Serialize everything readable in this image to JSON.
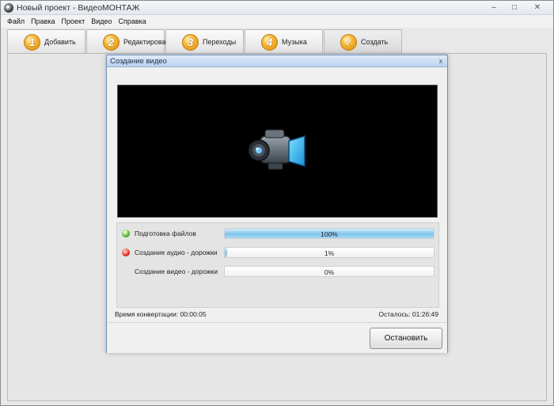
{
  "window": {
    "title": "Новый проект - ВидеоМОНТАЖ",
    "icon": "app-logo-icon",
    "controls": {
      "minimize": "–",
      "maximize": "□",
      "close": "✕"
    }
  },
  "menu": [
    "Файл",
    "Правка",
    "Проект",
    "Видео",
    "Справка"
  ],
  "tabs": [
    {
      "num": "1",
      "label": "Добавить"
    },
    {
      "num": "2",
      "label": "Редактировать"
    },
    {
      "num": "3",
      "label": "Переходы"
    },
    {
      "num": "4",
      "label": "Музыка"
    },
    {
      "num": "✓",
      "label": "Создать",
      "active": true
    }
  ],
  "dialog": {
    "title": "Создание видео",
    "close": "x",
    "preview_icon": "video-camera-icon",
    "tasks": [
      {
        "label": "Подготовка файлов",
        "percent_text": "100%",
        "progress": 1.0,
        "status": "done",
        "status_icon": "check-green-icon"
      },
      {
        "label": "Создание аудио - дорожки",
        "percent_text": "1%",
        "progress": 0.01,
        "status": "in-progress",
        "status_icon": "red-dot-icon"
      },
      {
        "label": "Создание видео - дорожки",
        "percent_text": "0%",
        "progress": 0.0,
        "status": "pending",
        "status_icon": ""
      }
    ],
    "conversion_time": "Время конвертации: 00:00:05",
    "remaining": "Осталось: 01:26:49",
    "stop_button": "Остановить"
  },
  "colors": {
    "accent": "#7fc4ec",
    "tab_badge": "#f7b733",
    "dialog_border": "#6f93bd"
  }
}
